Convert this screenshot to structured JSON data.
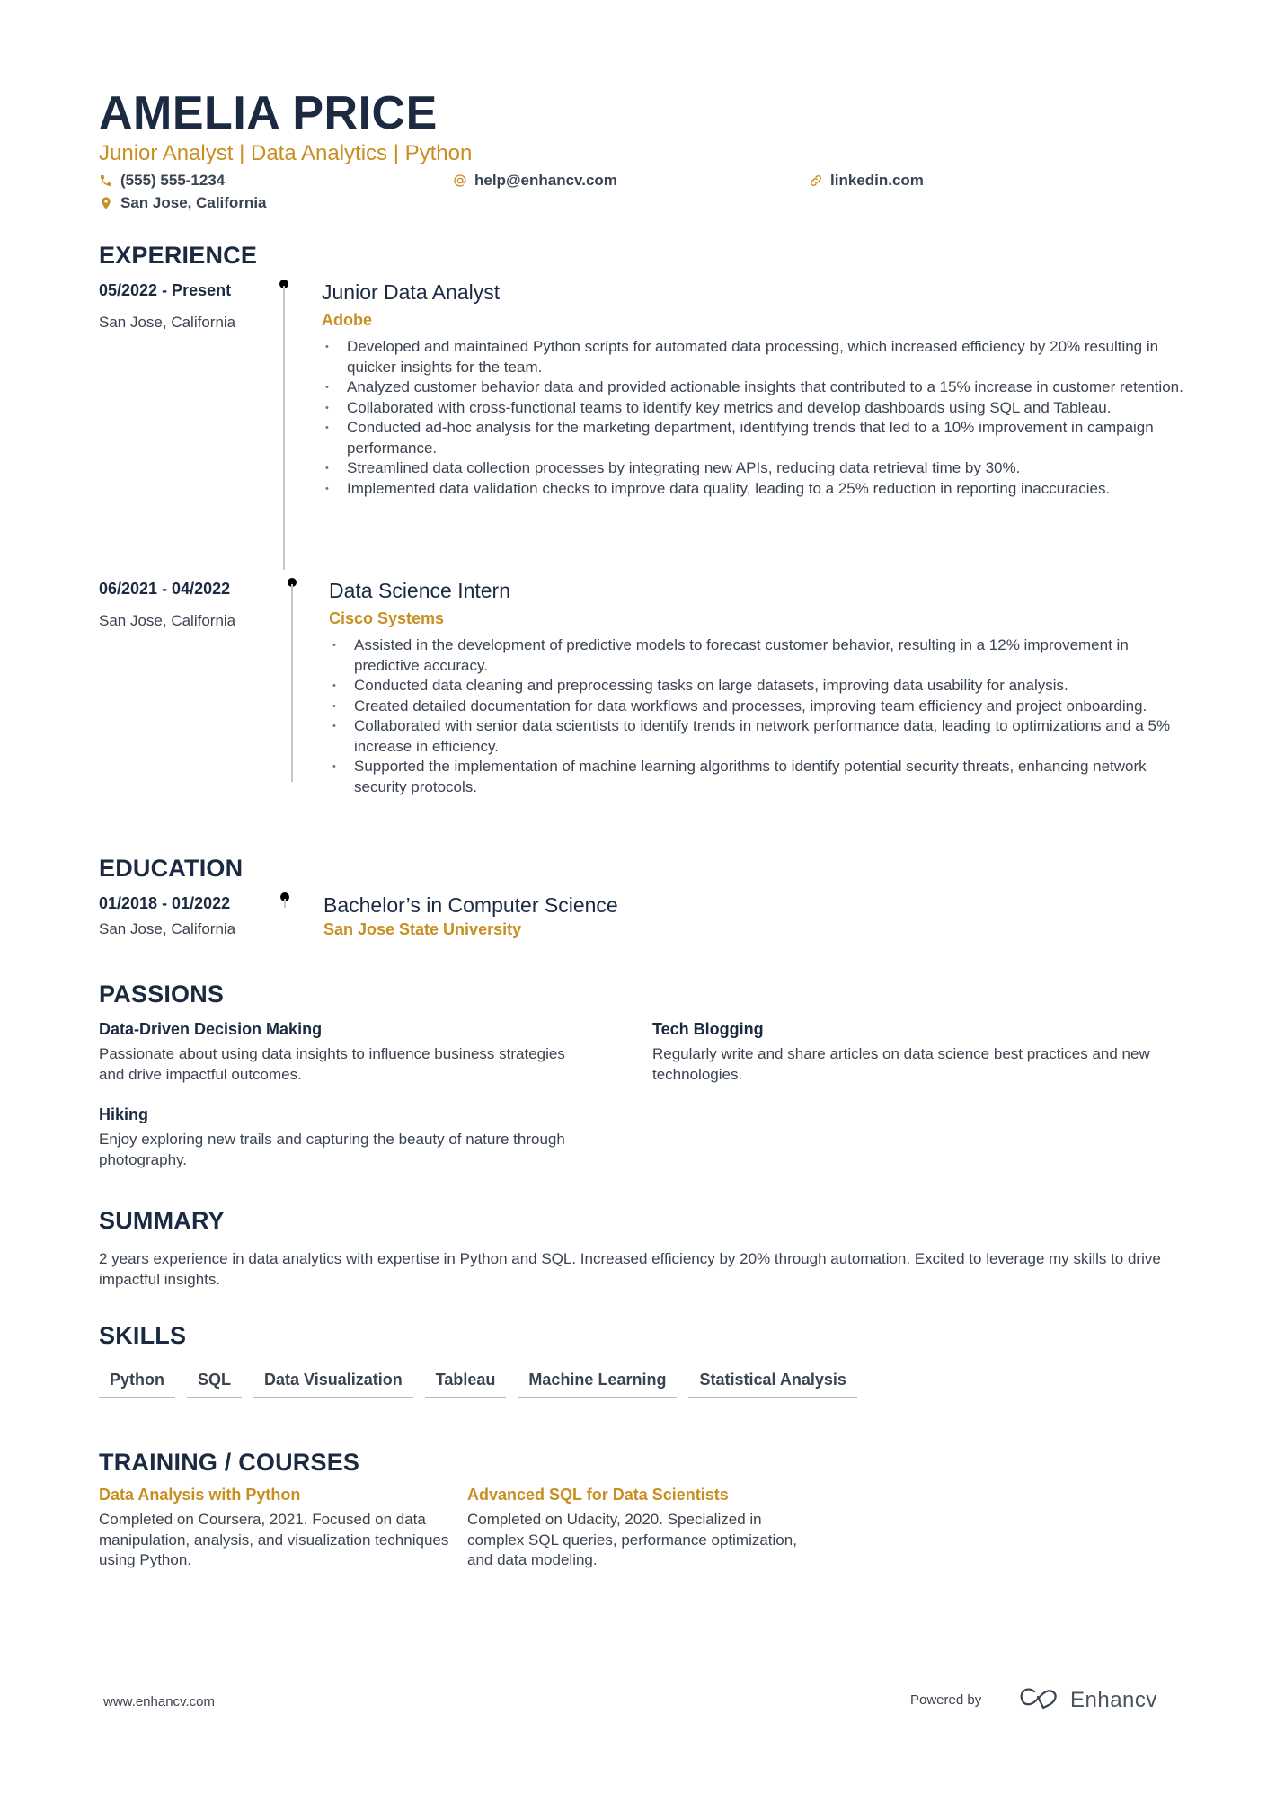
{
  "header": {
    "name": "AMELIA PRICE",
    "headline": "Junior Analyst | Data Analytics | Python",
    "contacts": {
      "phone": {
        "icon": "phone-icon",
        "text": "(555) 555-1234"
      },
      "email": {
        "icon": "at-icon",
        "text": "help@enhancv.com"
      },
      "linkedin": {
        "icon": "link-icon",
        "text": "linkedin.com"
      },
      "location": {
        "icon": "location-pin-icon",
        "text": "San Jose, California"
      }
    }
  },
  "colors": {
    "accent": "#c98e21",
    "heading": "#1b2a41",
    "body": "#3a4350",
    "timeline": "#c7c7c7"
  },
  "sections": {
    "experience": "EXPERIENCE",
    "education": "EDUCATION",
    "passions": "PASSIONS",
    "summary": "SUMMARY",
    "skills": "SKILLS",
    "training": "TRAINING / COURSES"
  },
  "experience": [
    {
      "dates": "05/2022 - Present",
      "location": "San Jose, California",
      "role": "Junior Data Analyst",
      "company": "Adobe",
      "bullets": [
        "Developed and maintained Python scripts for automated data processing, which increased efficiency by 20% resulting in quicker insights for the team.",
        "Analyzed customer behavior data and provided actionable insights that contributed to a 15% increase in customer retention.",
        "Collaborated with cross-functional teams to identify key metrics and develop dashboards using SQL and Tableau.",
        "Conducted ad-hoc analysis for the marketing department, identifying trends that led to a 10% improvement in campaign performance.",
        "Streamlined data collection processes by integrating new APIs, reducing data retrieval time by 30%.",
        "Implemented data validation checks to improve data quality, leading to a 25% reduction in reporting inaccuracies."
      ]
    },
    {
      "dates": "06/2021 - 04/2022",
      "location": "San Jose, California",
      "role": "Data Science Intern",
      "company": "Cisco Systems",
      "bullets": [
        "Assisted in the development of predictive models to forecast customer behavior, resulting in a 12% improvement in predictive accuracy.",
        "Conducted data cleaning and preprocessing tasks on large datasets, improving data usability for analysis.",
        "Created detailed documentation for data workflows and processes, improving team efficiency and project onboarding.",
        "Collaborated with senior data scientists to identify trends in network performance data, leading to optimizations and a 5% increase in efficiency.",
        "Supported the implementation of machine learning algorithms to identify potential security threats, enhancing network security protocols."
      ]
    }
  ],
  "education": [
    {
      "dates": "01/2018 - 01/2022",
      "location": "San Jose, California",
      "degree": "Bachelor’s in Computer Science",
      "school": "San Jose State University"
    }
  ],
  "passions": [
    {
      "title": "Data-Driven Decision Making",
      "description": "Passionate about using data insights to influence business strategies and drive impactful outcomes."
    },
    {
      "title": "Tech Blogging",
      "description": "Regularly write and share articles on data science best practices and new technologies."
    },
    {
      "title": "Hiking",
      "description": "Enjoy exploring new trails and capturing the beauty of nature through photography."
    }
  ],
  "summary": "2 years experience in data analytics with expertise in Python and SQL. Increased efficiency by 20% through automation. Excited to leverage my skills to drive impactful insights.",
  "skills": [
    "Python",
    "SQL",
    "Data Visualization",
    "Tableau",
    "Machine Learning",
    "Statistical Analysis"
  ],
  "training": [
    {
      "title": "Data Analysis with Python",
      "description": "Completed on Coursera, 2021. Focused on data manipulation, analysis, and visualization techniques using Python."
    },
    {
      "title": "Advanced SQL for Data Scientists",
      "description": "Completed on Udacity, 2020. Specialized in complex SQL queries, performance optimization, and data modeling."
    }
  ],
  "footer": {
    "url": "www.enhancv.com",
    "powered_by": "Powered by",
    "brand": "Enhancv",
    "brand_icon": "enhancv-logo-icon"
  }
}
